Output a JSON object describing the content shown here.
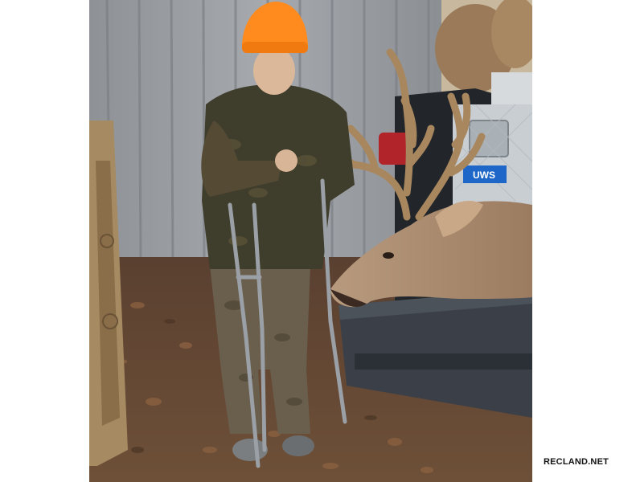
{
  "photo": {
    "subject": "hunter-with-whitetail-buck",
    "colors": {
      "hat": "#ff8a1e",
      "wall": "#9a9ea3",
      "leaves": "#6b4a32",
      "tailgate": "#3b4048",
      "toolbox": "#c9ced3",
      "badge": "#1e66c8"
    }
  },
  "toolbox_badge": {
    "text": "UWS"
  },
  "watermark": {
    "text": "RECLAND.NET"
  }
}
